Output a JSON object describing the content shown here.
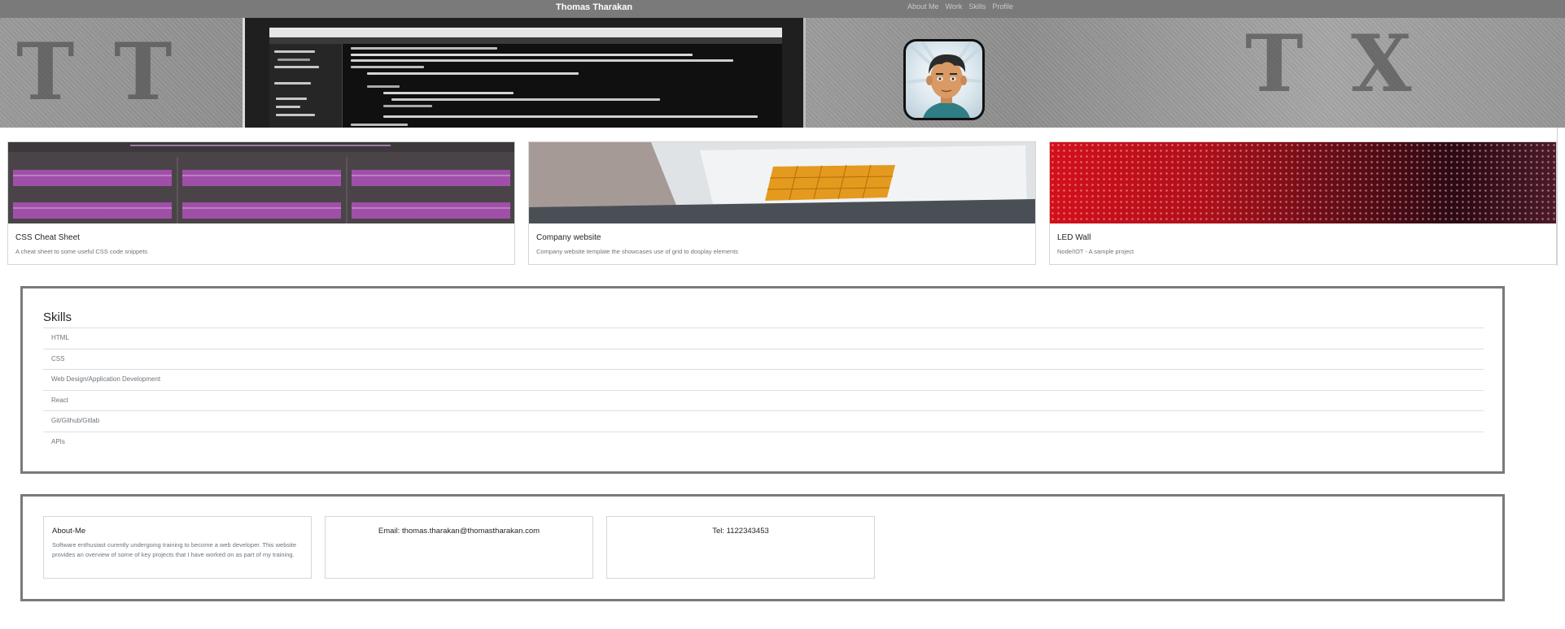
{
  "navbar": {
    "brand": "Thomas Tharakan",
    "links": [
      "About Me",
      "Work",
      "Skills",
      "Profile"
    ]
  },
  "hero": {
    "background_letters": [
      "T",
      "T",
      "T",
      "X"
    ],
    "avatar_icon": "cartoon-man-avatar"
  },
  "projects": [
    {
      "title": "CSS Cheat Sheet",
      "description": "A cheat sheet to some useful CSS code snippets",
      "image": "purple-code-grid"
    },
    {
      "title": "Company website",
      "description": "Company website template the showcases use of grid to dosplay elements",
      "image": "laptop-keyboard-orange"
    },
    {
      "title": "LED Wall",
      "description": "Node/IOT - A sample project",
      "image": "red-led-wall"
    }
  ],
  "skills": {
    "title": "Skills",
    "items": [
      "HTML",
      "CSS",
      "Web Design/Application Development",
      "React",
      "Git/Github/Gitlab",
      "APIs"
    ]
  },
  "contact": {
    "about_title": "About-Me",
    "about_text": "Software enthusiast curently undergoing training to become a web developer. This website provides an overview of some of key projects that I have worked on as part of my training.",
    "email": "Email: thomas.tharakan@thomastharakan.com",
    "tel": "Tel: 1122343453"
  },
  "colors": {
    "navbar": "#7a7a7a",
    "box_border": "#7a7a7a",
    "muted_text": "#6c757d"
  }
}
